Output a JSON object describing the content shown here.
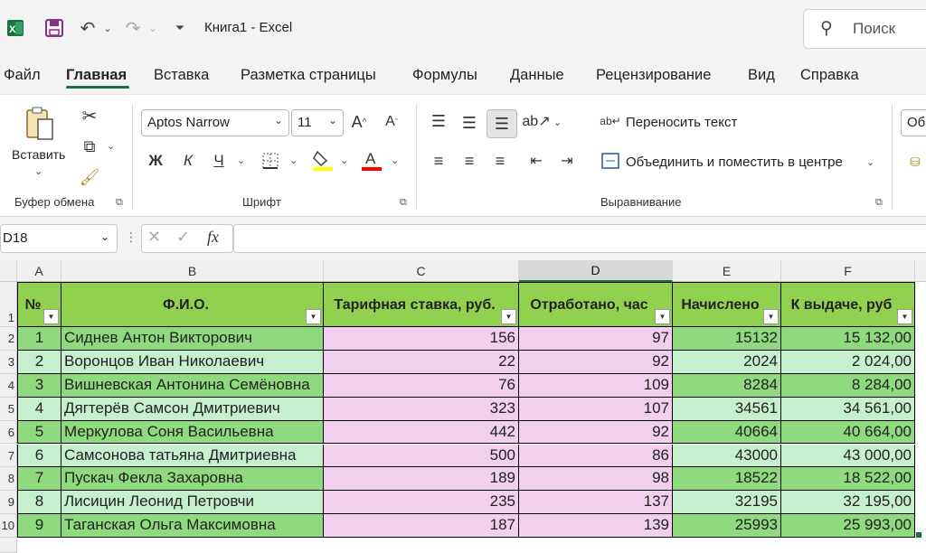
{
  "app": {
    "title": "Книга1  -  Excel",
    "search_placeholder": "Поиск"
  },
  "tabs": [
    "Файл",
    "Главная",
    "Вставка",
    "Разметка страницы",
    "Формулы",
    "Данные",
    "Рецензирование",
    "Вид",
    "Справка"
  ],
  "active_tab": "Главная",
  "ribbon": {
    "clipboard": {
      "paste_label": "Вставить",
      "group_label": "Буфер обмена"
    },
    "font": {
      "font_name": "Aptos Narrow",
      "font_size": "11",
      "bold": "Ж",
      "italic": "К",
      "underline": "Ч",
      "group_label": "Шрифт",
      "fill_color": "#ffff00",
      "font_color": "#ff0000"
    },
    "alignment": {
      "wrap_text": "Переносить текст",
      "merge_center": "Объединить и поместить в центре",
      "group_label": "Выравнивание"
    },
    "number": {
      "format_partial": "Об"
    }
  },
  "formula_bar": {
    "name_box": "D18",
    "formula": ""
  },
  "sheet": {
    "columns": [
      "A",
      "B",
      "C",
      "D",
      "E",
      "F"
    ],
    "selected_column": "D",
    "row_numbers": [
      "1",
      "2",
      "3",
      "4",
      "5",
      "6",
      "7",
      "8",
      "9",
      "10"
    ],
    "headers": [
      "№",
      "Ф.И.О.",
      "Тарифная ставка, руб.",
      "Отработано, час",
      "Начислено",
      "К выдаче, руб"
    ],
    "rows": [
      [
        "1",
        "Сиднев Антон Викторович",
        "156",
        "97",
        "15132",
        "15 132,00"
      ],
      [
        "2",
        "Воронцов  Иван Николаевич",
        "22",
        "92",
        "2024",
        "2 024,00"
      ],
      [
        "3",
        "Вишневская Антонина Семёновна",
        "76",
        "109",
        "8284",
        "8 284,00"
      ],
      [
        "4",
        "Дягтерёв Самсон Дмитриевич",
        "323",
        "107",
        "34561",
        "34 561,00"
      ],
      [
        "5",
        "Меркулова Соня Васильевна",
        "442",
        "92",
        "40664",
        "40 664,00"
      ],
      [
        "6",
        "Самсонова татьяна Дмитриевна",
        "500",
        "86",
        "43000",
        "43 000,00"
      ],
      [
        "7",
        "Пускач Фекла Захаровна",
        "189",
        "98",
        "18522",
        "18 522,00"
      ],
      [
        "8",
        "Лисицин Леонид Петровчи",
        "235",
        "137",
        "32195",
        "32 195,00"
      ],
      [
        "9",
        "Таганская Ольга Максимовна",
        "187",
        "139",
        "25993",
        "25 993,00"
      ]
    ],
    "colors": {
      "header_green": "#92d050",
      "row_green_dark": "#8fd97e",
      "row_green_light": "#c6efce",
      "pink": "#f2cfee",
      "accent": "#1e7145"
    }
  }
}
